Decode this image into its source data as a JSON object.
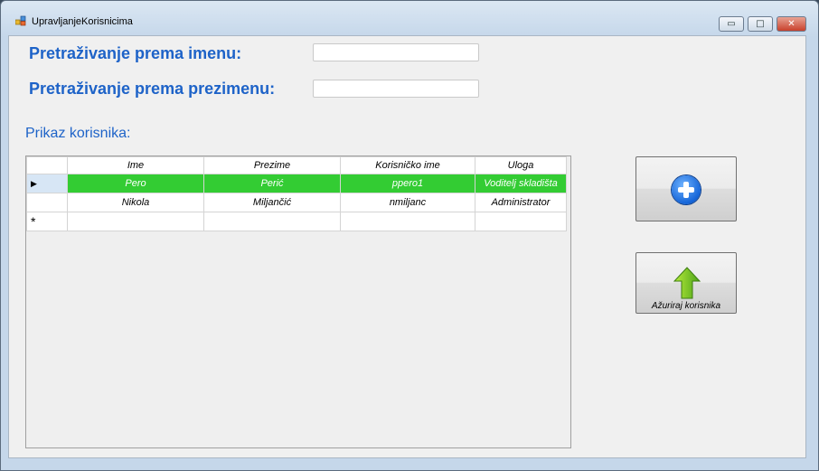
{
  "window": {
    "title": "UpravljanjeKorisnicima",
    "controls": {
      "minimize": "▭",
      "maximize": "□",
      "close": "✕"
    }
  },
  "search": {
    "name_label": "Pretraživanje prema imenu:",
    "name_value": "",
    "surname_label": "Pretraživanje prema prezimenu:",
    "surname_value": ""
  },
  "list_label": "Prikaz korisnika:",
  "grid": {
    "columns": [
      "Ime",
      "Prezime",
      "Korisničko ime",
      "Uloga"
    ],
    "rows": [
      {
        "ime": "Pero",
        "prezime": "Perić",
        "korisnicko_ime": "ppero1",
        "uloga": "Voditelj skladišta",
        "selected": true
      },
      {
        "ime": "Nikola",
        "prezime": "Miljančić",
        "korisnicko_ime": "nmiljanc",
        "uloga": "Administrator",
        "selected": false
      }
    ],
    "current_row_marker": "▶",
    "new_row_marker": "*"
  },
  "buttons": {
    "add_icon": "plus-circle-icon",
    "update_label": "Ažuriraj korisnika",
    "update_icon": "up-arrow-icon"
  },
  "colors": {
    "label_blue": "#1e63c8",
    "selected_row": "#33cc33"
  }
}
